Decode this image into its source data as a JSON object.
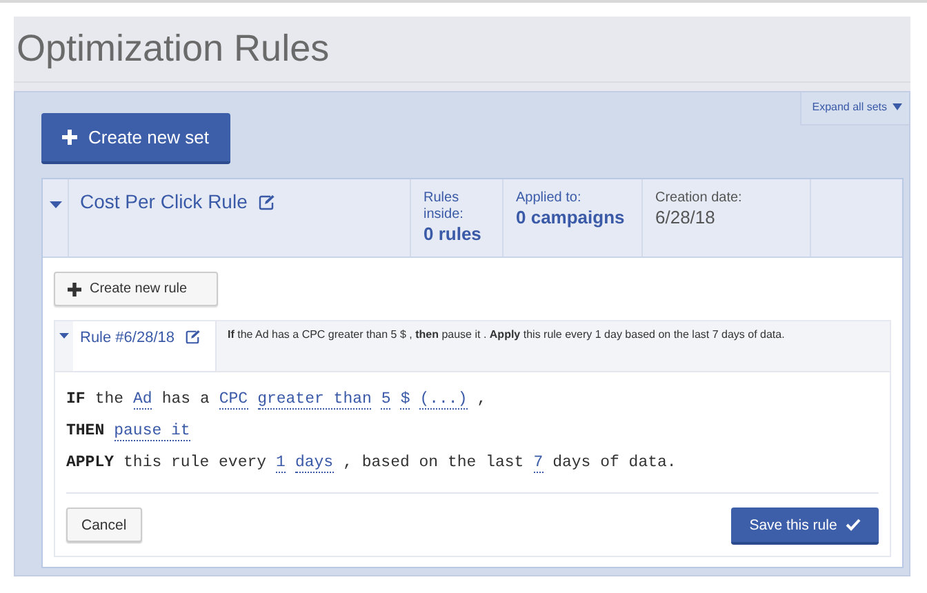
{
  "page_title": "Optimization Rules",
  "expand_all": "Expand all sets",
  "create_set": "Create new set",
  "rule_set": {
    "expanded": true,
    "title": "Cost Per Click Rule",
    "stats": [
      {
        "label": "Rules inside:",
        "value": "0 rules",
        "kind": "link"
      },
      {
        "label": "Applied to:",
        "value": "0 campaigns",
        "kind": "link"
      },
      {
        "label": "Creation date:",
        "value": "6/28/18",
        "kind": "plain"
      }
    ],
    "create_rule": "Create new rule",
    "rule": {
      "expanded": true,
      "name": "Rule #6/28/18",
      "summary": "**If** the Ad has a CPC greater than 5 $ , **then** pause it . **Apply** this rule every 1 day based on the last 7 days of data.",
      "lines": [
        [
          {
            "kind": "keyword",
            "text": "IF"
          },
          {
            "kind": "text",
            "text": "the"
          },
          {
            "kind": "value",
            "text": "Ad"
          },
          {
            "kind": "text",
            "text": "has a"
          },
          {
            "kind": "value",
            "text": "CPC"
          },
          {
            "kind": "value",
            "text": "greater than"
          },
          {
            "kind": "value",
            "text": "5"
          },
          {
            "kind": "value",
            "text": "$"
          },
          {
            "kind": "value",
            "text": "(...)"
          },
          {
            "kind": "text",
            "text": ","
          }
        ],
        [
          {
            "kind": "keyword",
            "text": "THEN"
          },
          {
            "kind": "value",
            "text": "pause it"
          }
        ],
        [
          {
            "kind": "keyword",
            "text": "APPLY"
          },
          {
            "kind": "text",
            "text": "this rule every"
          },
          {
            "kind": "value",
            "text": "1"
          },
          {
            "kind": "value",
            "text": "days"
          },
          {
            "kind": "text",
            "text": ", based on the last"
          },
          {
            "kind": "value",
            "text": "7"
          },
          {
            "kind": "text",
            "text": "days of data."
          }
        ]
      ],
      "cancel": "Cancel",
      "save": "Save this rule"
    }
  }
}
